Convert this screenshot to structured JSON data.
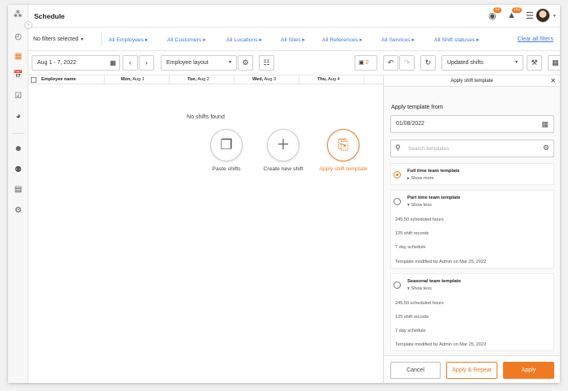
{
  "header": {
    "title": "Schedule",
    "messages_badge": "10",
    "notifications_badge": "151"
  },
  "filters": {
    "selected": "No filters selected",
    "links": [
      "All Employees",
      "All Customers",
      "All Locations",
      "All Sites",
      "All References",
      "All Services",
      "All Shift statuses"
    ],
    "clear_all": "Clear all filters"
  },
  "toolbar": {
    "date_range": "Aug 1 - 7, 2022",
    "layout": "Employee layout",
    "count": "2",
    "view": "Updated shifts"
  },
  "grid": {
    "employee_col": "Employee name",
    "days": [
      {
        "day": "Mon,",
        "date": "Aug 1"
      },
      {
        "day": "Tue,",
        "date": "Aug 2"
      },
      {
        "day": "Wed,",
        "date": "Aug 3"
      },
      {
        "day": "Thu,",
        "date": "Aug 4"
      }
    ]
  },
  "empty_state": {
    "message": "No shifts found",
    "actions": [
      {
        "label": "Paste shifts"
      },
      {
        "label": "Create new shift"
      },
      {
        "label": "Apply shift template"
      }
    ]
  },
  "panel": {
    "title": "Apply shift template",
    "subtitle": "Apply template from",
    "date": "01/08/2022",
    "search_placeholder": "Search templates",
    "templates": [
      {
        "name": "Full time team template",
        "toggle": "Show more",
        "selected": true
      },
      {
        "name": "Part time team template",
        "toggle": "Show less",
        "selected": false,
        "details": [
          "245.50 scheduled hours",
          "125 shift records",
          "7 day schedule",
          "Template modified by Admin on Mar 25, 2022"
        ]
      },
      {
        "name": "Seasonal team template",
        "toggle": "Show less",
        "selected": false,
        "details": [
          "245.50 scheduled hours",
          "125 shift records",
          "7 day schedule",
          "Template modified by Admin on Mar 25, 2022"
        ]
      }
    ],
    "buttons": {
      "cancel": "Cancel",
      "apply_repeat": "Apply & Repeat",
      "apply": "Apply"
    }
  },
  "colors": {
    "accent": "#f07a24",
    "link": "#3d7be0"
  }
}
